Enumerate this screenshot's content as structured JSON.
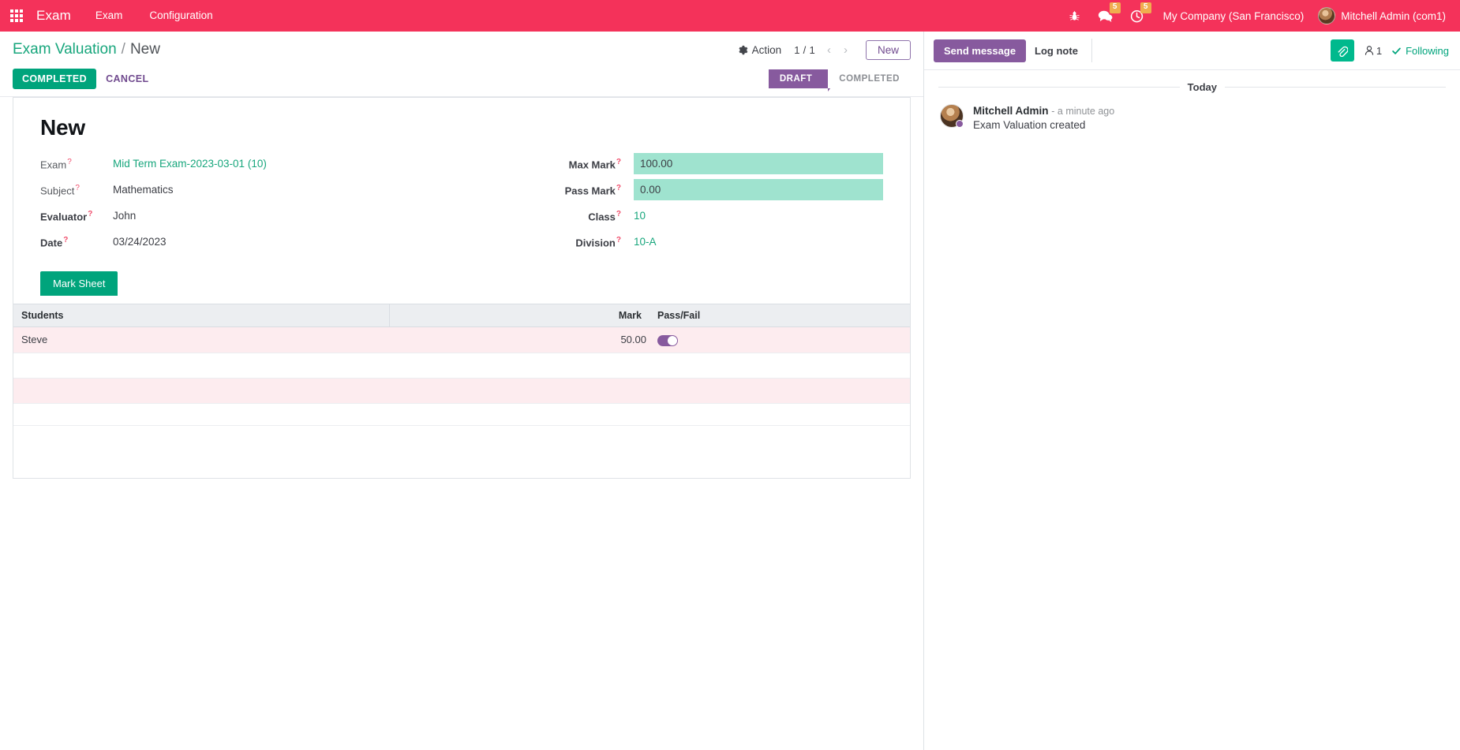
{
  "navbar": {
    "apps_icon": "grid-apps-icon",
    "brand": "Exam",
    "menu_items": [
      {
        "label": "Exam"
      },
      {
        "label": "Configuration"
      }
    ],
    "bug_icon": "bug-icon",
    "messages_icon": "messages-icon",
    "messages_badge": "5",
    "activities_icon": "clock-activity-icon",
    "activities_badge": "5",
    "company": "My Company (San Francisco)",
    "user": "Mitchell Admin (com1)",
    "brand_color": "#f4325a"
  },
  "control_panel": {
    "breadcrumb_root": "Exam Valuation",
    "breadcrumb_separator": "/",
    "breadcrumb_current": "New",
    "action_label": "Action",
    "action_icon": "gear-icon",
    "pager": "1 / 1",
    "prev_icon": "chevron-left-icon",
    "next_icon": "chevron-right-icon",
    "new_button": "New",
    "save_button": "COMPLETED",
    "discard_button": "CANCEL",
    "statuses": [
      {
        "label": "DRAFT",
        "active": true
      },
      {
        "label": "COMPLETED",
        "active": false
      }
    ]
  },
  "form": {
    "record_title": "New",
    "left_fields": [
      {
        "label": "Exam",
        "value": "Mid Term Exam-2023-03-01 (10)",
        "style": "link",
        "required": false
      },
      {
        "label": "Subject",
        "value": "Mathematics",
        "style": "text",
        "required": false
      },
      {
        "label": "Evaluator",
        "value": "John",
        "style": "text",
        "required": true
      },
      {
        "label": "Date",
        "value": "03/24/2023",
        "style": "text",
        "required": true
      }
    ],
    "right_fields": [
      {
        "label": "Max Mark",
        "value": "100.00",
        "style": "modified",
        "required": true
      },
      {
        "label": "Pass Mark",
        "value": "0.00",
        "style": "modified",
        "required": true
      },
      {
        "label": "Class",
        "value": "10",
        "style": "link",
        "required": true
      },
      {
        "label": "Division",
        "value": "10-A",
        "style": "link",
        "required": true
      }
    ],
    "tooltip_marker": "?",
    "notebook": {
      "tabs": [
        {
          "label": "Mark Sheet",
          "active": true
        }
      ],
      "columns": [
        "Students",
        "Mark",
        "Pass/Fail"
      ],
      "rows": [
        {
          "student": "Steve",
          "mark": "50.00",
          "pass_fail": true,
          "invalid": true
        }
      ]
    }
  },
  "chatter": {
    "send_message": "Send message",
    "log_note": "Log note",
    "attach_icon": "paperclip-icon",
    "follower_icon": "user-follower-icon",
    "follower_count": "1",
    "following_icon": "check-icon",
    "following_label": "Following",
    "date_separator": "Today",
    "messages": [
      {
        "author": "Mitchell Admin",
        "time": "- a minute ago",
        "body": "Exam Valuation created",
        "avatar": "user-avatar"
      }
    ]
  }
}
